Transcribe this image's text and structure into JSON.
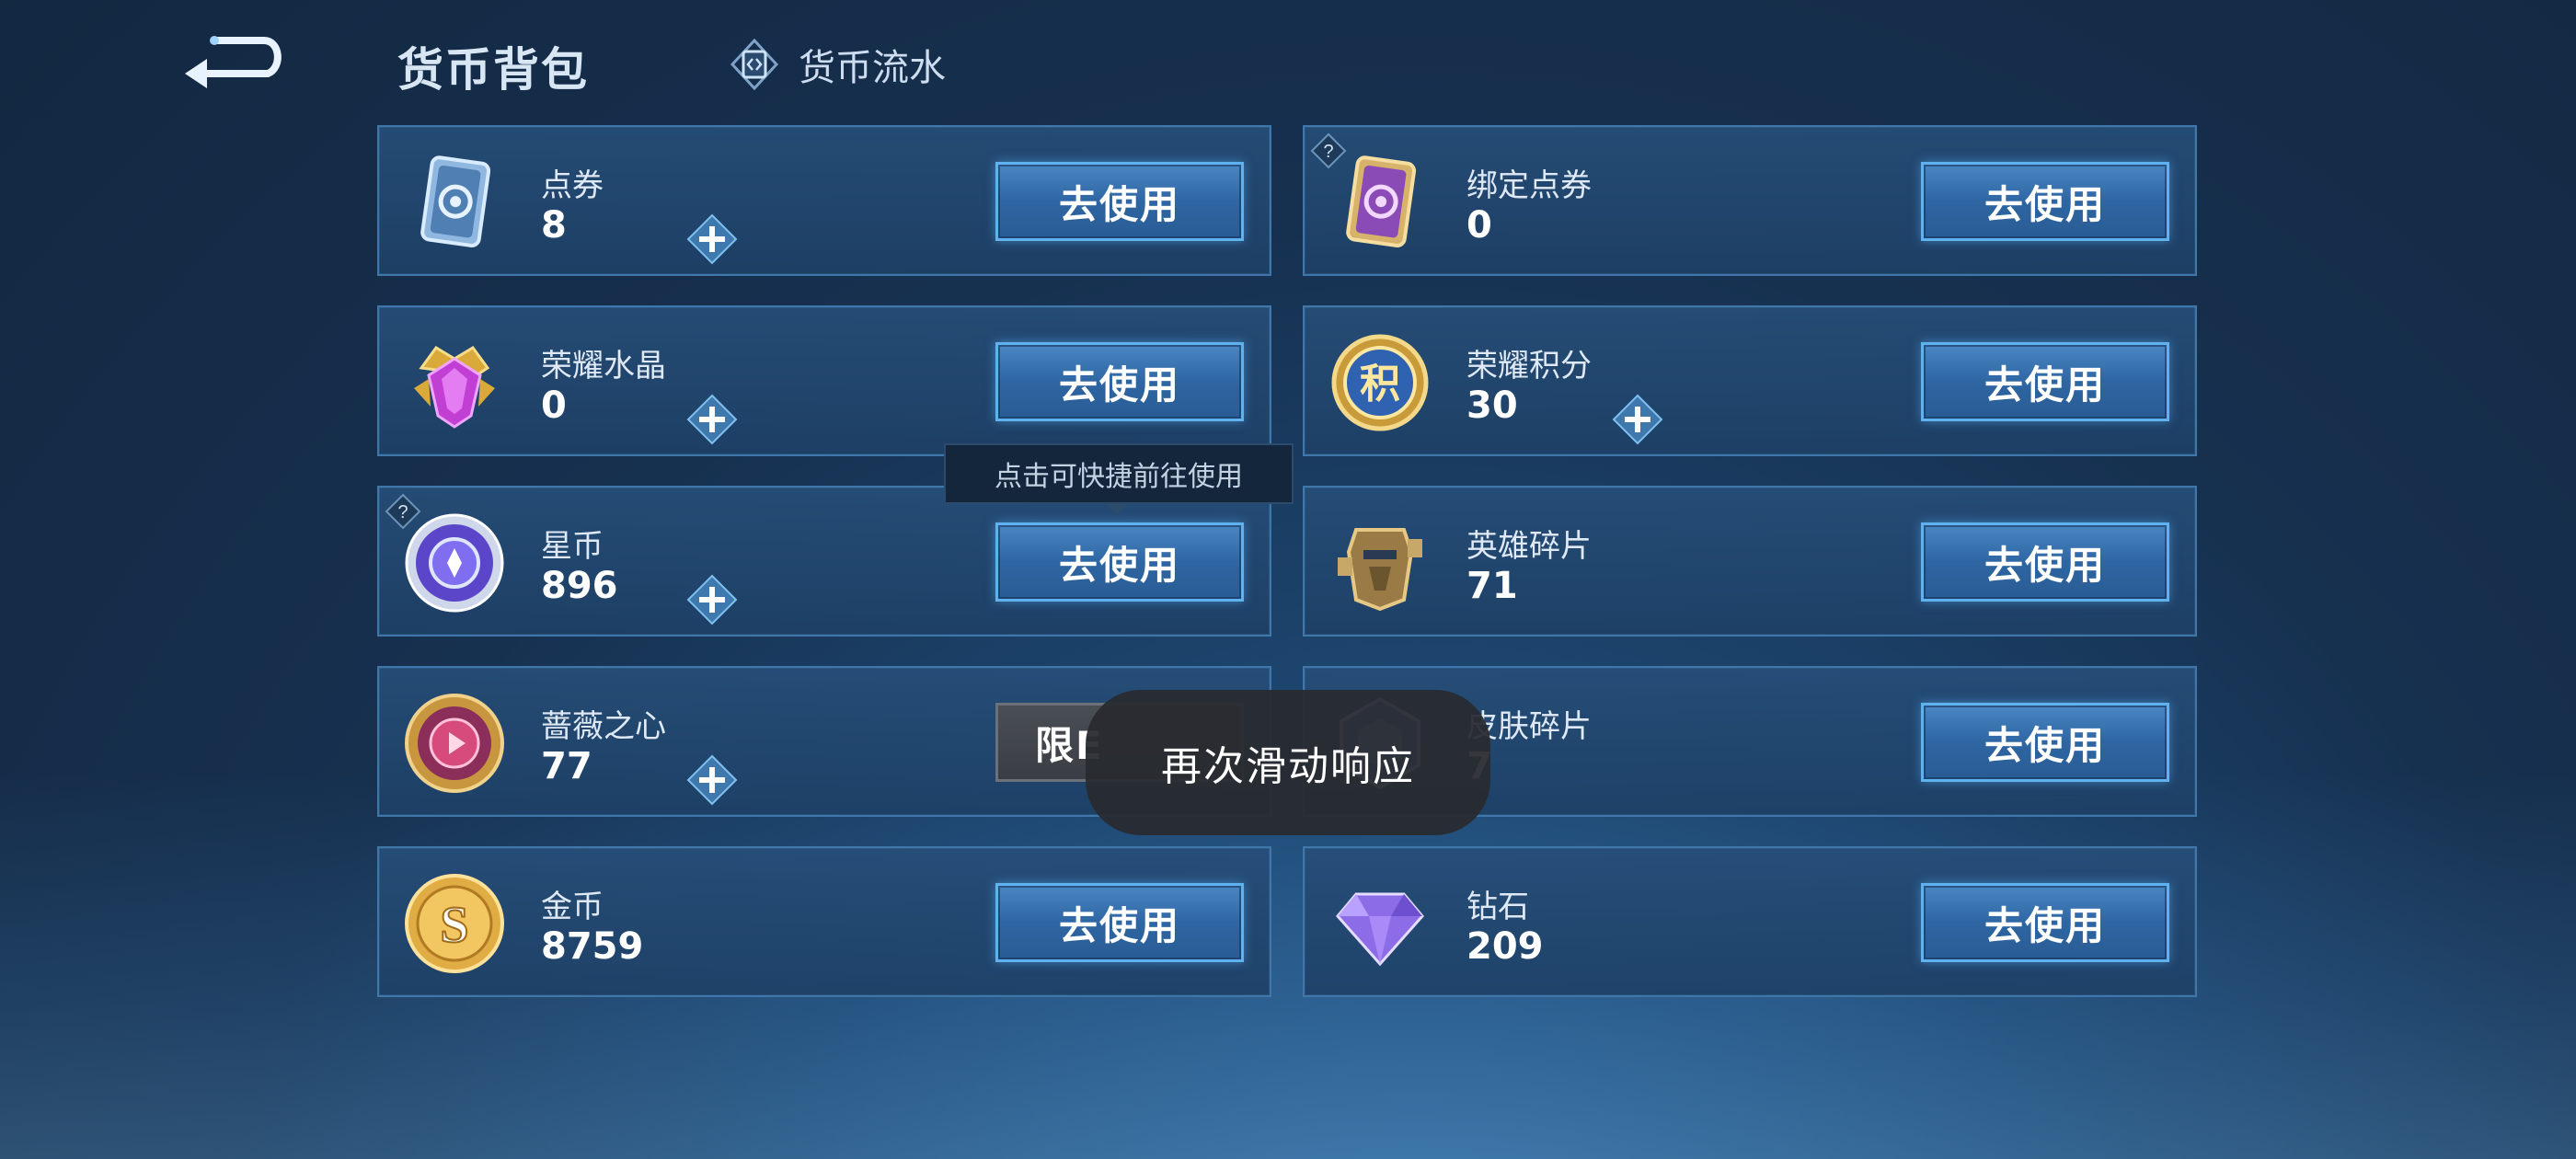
{
  "header": {
    "title": "货币背包",
    "ledger_label": "货币流水"
  },
  "currencies": [
    {
      "name": "点券",
      "amount": "8",
      "button": "去使用",
      "has_plus": true,
      "icon": "voucher-icon"
    },
    {
      "name": "绑定点券",
      "amount": "0",
      "button": "去使用",
      "has_plus": false,
      "icon": "bound-voucher-icon"
    },
    {
      "name": "荣耀水晶",
      "amount": "0",
      "button": "去使用",
      "has_plus": true,
      "icon": "glory-crystal-icon"
    },
    {
      "name": "荣耀积分",
      "amount": "30",
      "button": "去使用",
      "has_plus": true,
      "icon": "glory-points-icon"
    },
    {
      "name": "星币",
      "amount": "896",
      "button": "去使用",
      "has_plus": true,
      "icon": "star-coin-icon"
    },
    {
      "name": "英雄碎片",
      "amount": "71",
      "button": "去使用",
      "has_plus": false,
      "icon": "hero-fragment-icon"
    },
    {
      "name": "蔷薇之心",
      "amount": "77",
      "button": "限E",
      "has_plus": true,
      "icon": "rose-heart-icon"
    },
    {
      "name": "皮肤碎片",
      "amount": "7",
      "button": "去使用",
      "has_plus": false,
      "icon": "skin-fragment-icon"
    },
    {
      "name": "金币",
      "amount": "8759",
      "button": "去使用",
      "has_plus": false,
      "icon": "gold-coin-icon"
    },
    {
      "name": "钻石",
      "amount": "209",
      "button": "去使用",
      "has_plus": false,
      "icon": "diamond-icon"
    }
  ],
  "tooltip": "点击可快捷前往使用",
  "toast": "再次滑动响应",
  "colors": {
    "accent": "#5fb2ee",
    "card_bg": "#264e78",
    "button_blue": "#2e66a3"
  }
}
